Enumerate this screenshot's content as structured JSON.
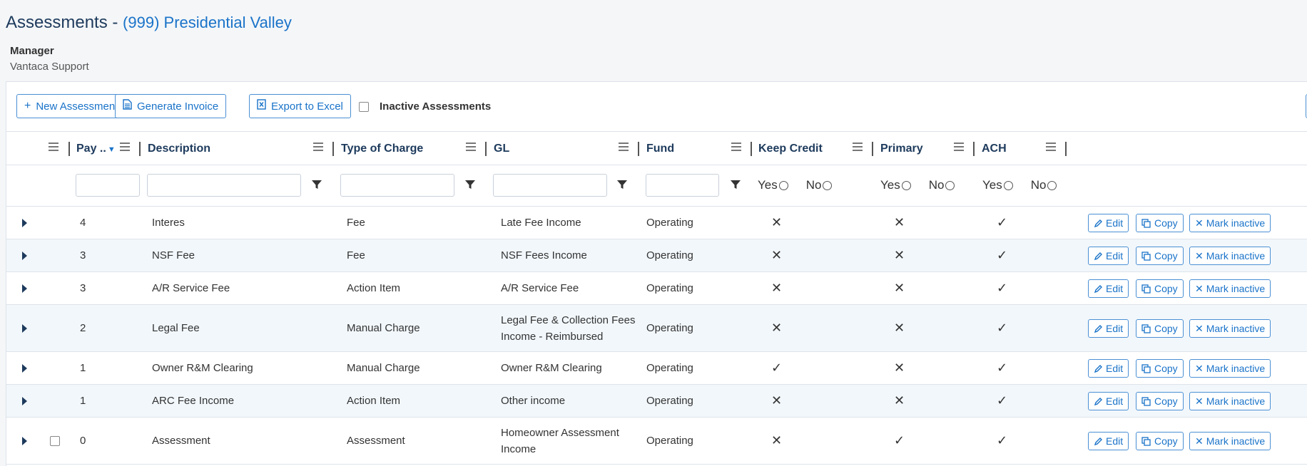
{
  "page": {
    "title": "Assessments -",
    "association": "(999) Presidential Valley",
    "manager_label": "Manager",
    "manager_name": "Vantaca Support"
  },
  "toolbar": {
    "new_assessment": "New Assessment",
    "generate_invoice": "Generate Invoice",
    "export_excel": "Export to Excel",
    "inactive_label": "Inactive Assessments"
  },
  "columns": {
    "pay": "Pay ..",
    "description": "Description",
    "type_of_charge": "Type of Charge",
    "gl": "GL",
    "fund": "Fund",
    "keep_credit": "Keep Credit",
    "primary": "Primary",
    "ach": "ACH"
  },
  "filters": {
    "yes": "Yes",
    "no": "No"
  },
  "row_actions": {
    "edit": "Edit",
    "copy": "Copy",
    "mark_inactive": "Mark inactive"
  },
  "rows": [
    {
      "pay": "4",
      "description": "Interes",
      "type": "Fee",
      "gl": "Late Fee Income",
      "fund": "Operating",
      "keep_credit": "✕",
      "primary": "✕",
      "ach": "✓"
    },
    {
      "pay": "3",
      "description": "NSF Fee",
      "type": "Fee",
      "gl": "NSF Fees Income",
      "fund": "Operating",
      "keep_credit": "✕",
      "primary": "✕",
      "ach": "✓"
    },
    {
      "pay": "3",
      "description": "A/R Service Fee",
      "type": "Action Item",
      "gl": "A/R Service Fee",
      "fund": "Operating",
      "keep_credit": "✕",
      "primary": "✕",
      "ach": "✓"
    },
    {
      "pay": "2",
      "description": "Legal Fee",
      "type": "Manual Charge",
      "gl": "Legal Fee & Collection Fees Income - Reimbursed",
      "fund": "Operating",
      "keep_credit": "✕",
      "primary": "✕",
      "ach": "✓"
    },
    {
      "pay": "1",
      "description": "Owner R&M Clearing",
      "type": "Manual Charge",
      "gl": "Owner R&M Clearing",
      "fund": "Operating",
      "keep_credit": "✓",
      "primary": "✕",
      "ach": "✓"
    },
    {
      "pay": "1",
      "description": "ARC Fee Income",
      "type": "Action Item",
      "gl": "Other income",
      "fund": "Operating",
      "keep_credit": "✕",
      "primary": "✕",
      "ach": "✓"
    },
    {
      "pay": "0",
      "description": "Assessment",
      "type": "Assessment",
      "gl": "Homeowner Assessment Income",
      "fund": "Operating",
      "keep_credit": "✕",
      "primary": "✓",
      "ach": "✓"
    }
  ],
  "colors": {
    "accent": "#1a73c9",
    "heading": "#1d3a5c",
    "row_alt": "#f2f7fb"
  }
}
